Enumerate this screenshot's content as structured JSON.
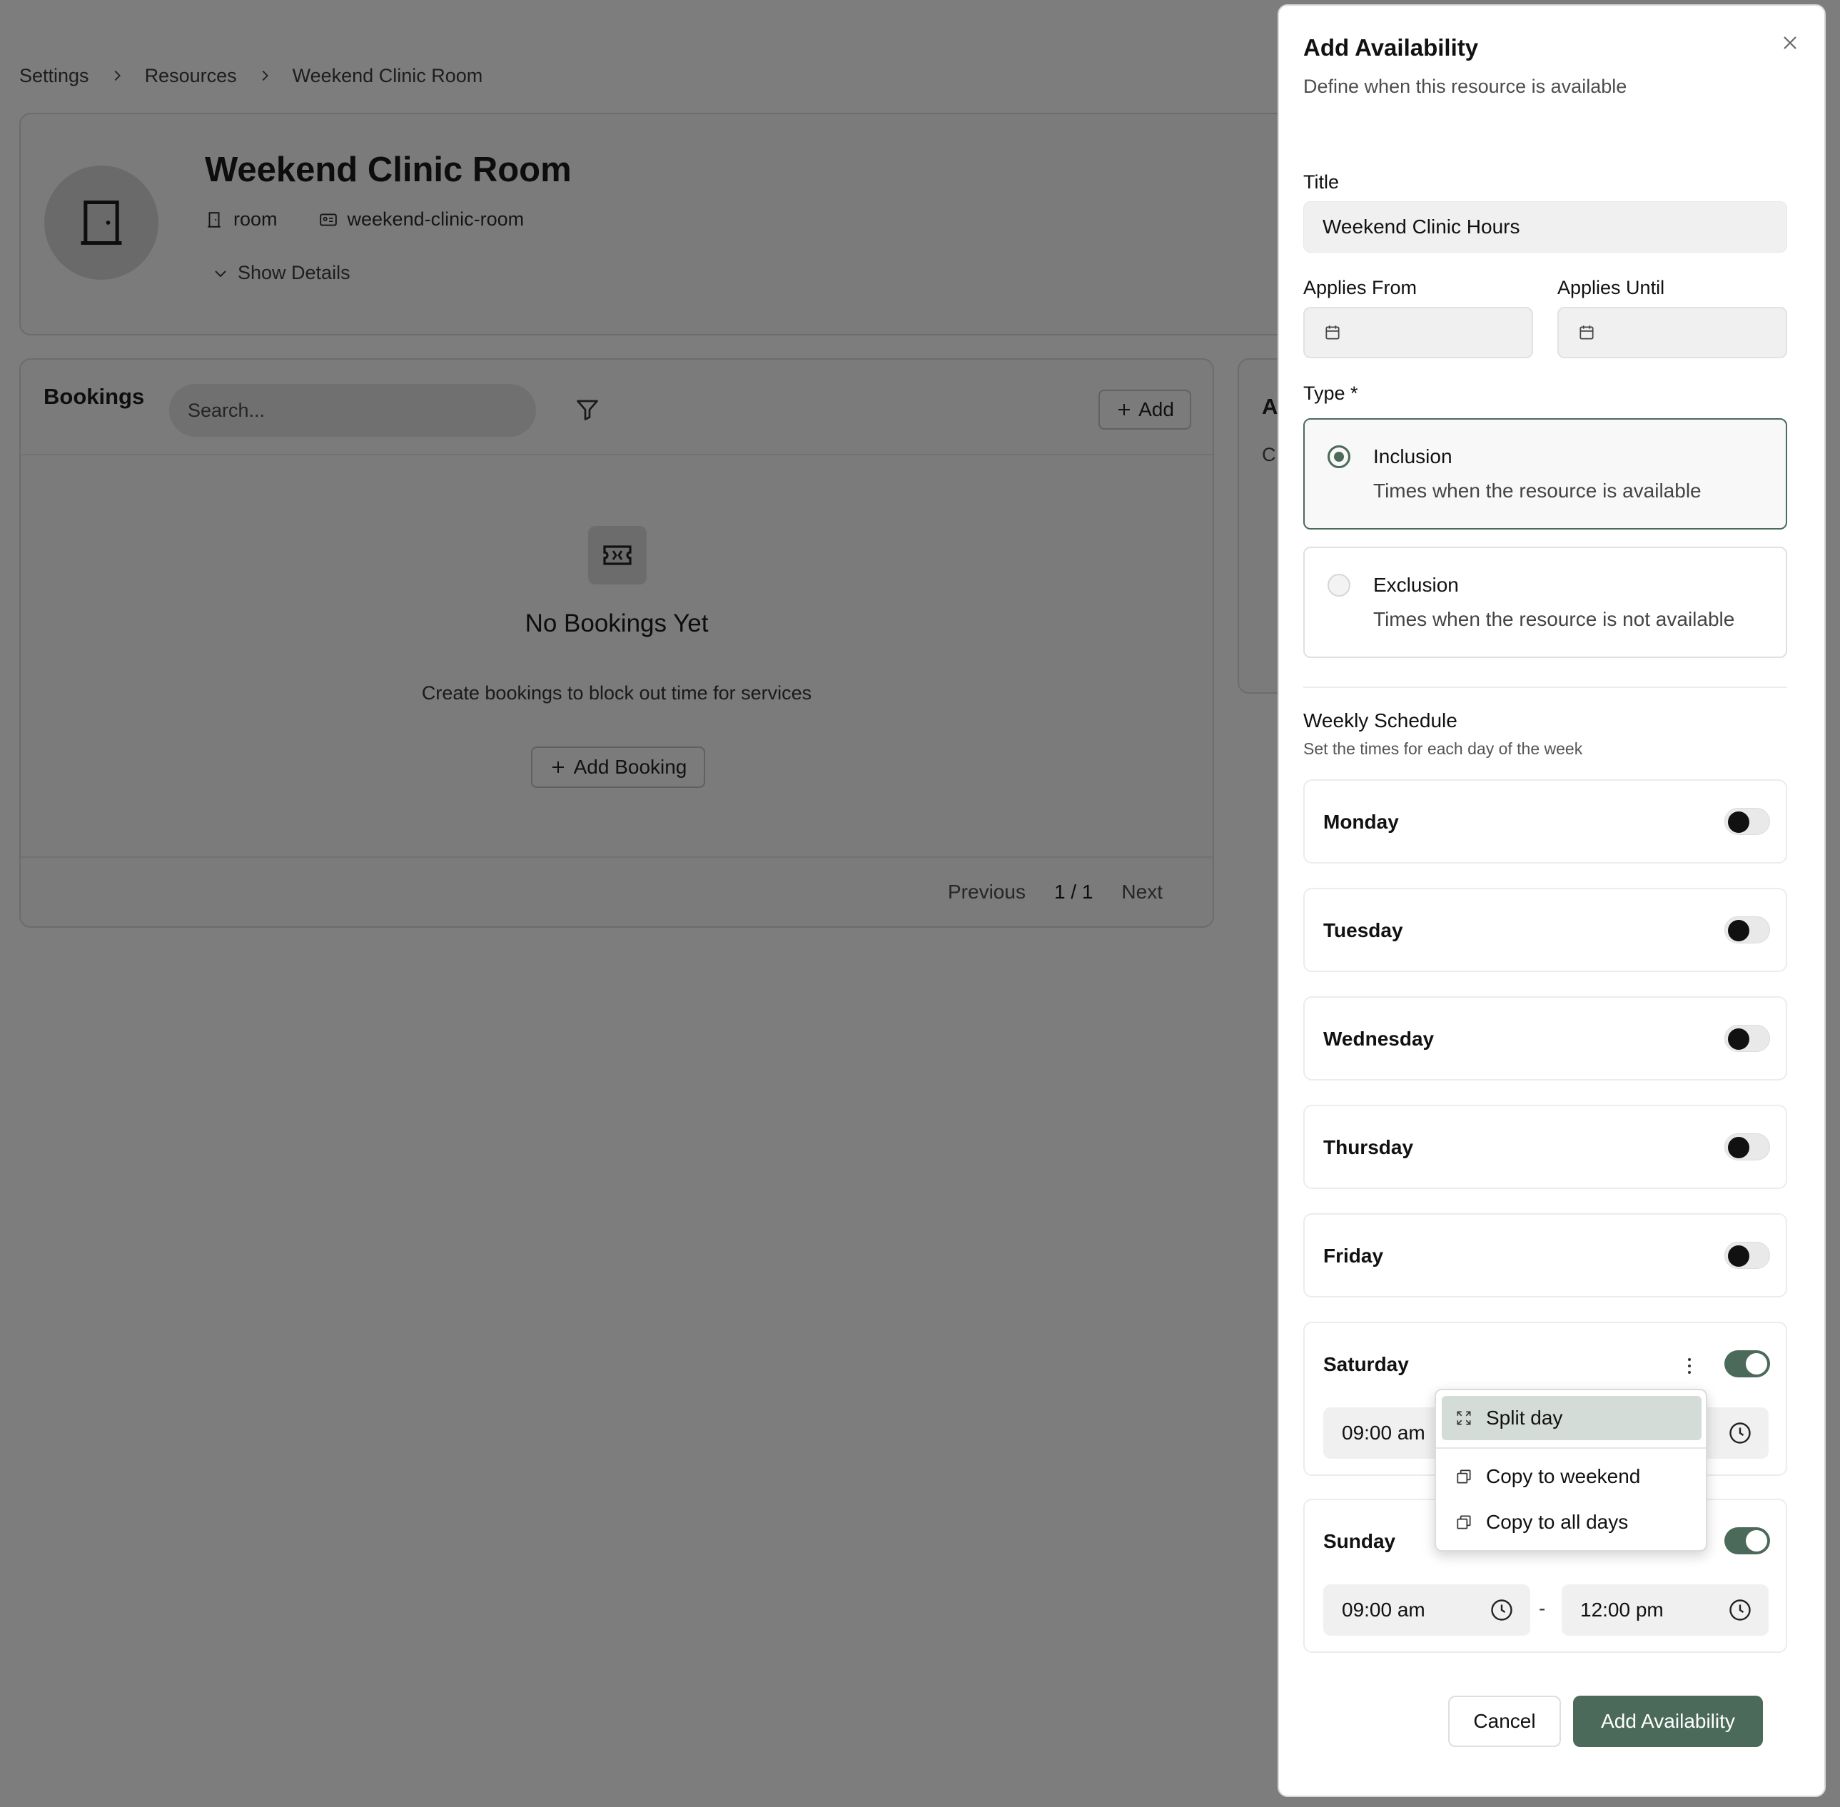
{
  "breadcrumb": [
    "Settings",
    "Resources",
    "Weekend Clinic Room"
  ],
  "resource": {
    "name": "Weekend Clinic Room",
    "type": "room",
    "slug": "weekend-clinic-room",
    "show_details": "Show Details"
  },
  "bookings": {
    "title": "Bookings",
    "search_placeholder": "Search...",
    "add_label": "Add",
    "empty_title": "No Bookings Yet",
    "empty_sub": "Create bookings to block out time for services",
    "add_booking_label": "Add Booking",
    "pager": {
      "prev": "Previous",
      "page": "1 / 1",
      "next": "Next"
    }
  },
  "side_card": {
    "title_initial": "A",
    "text_initial": "C"
  },
  "modal": {
    "title": "Add Availability",
    "subtitle": "Define when this resource is available",
    "title_label": "Title",
    "title_value": "Weekend Clinic Hours",
    "applies_from_label": "Applies From",
    "applies_until_label": "Applies Until",
    "type_label": "Type *",
    "options": [
      {
        "title": "Inclusion",
        "desc": "Times when the resource is available",
        "selected": true
      },
      {
        "title": "Exclusion",
        "desc": "Times when the resource is not available",
        "selected": false
      }
    ],
    "weekly_title": "Weekly Schedule",
    "weekly_sub": "Set the times for each day of the week",
    "days": [
      {
        "name": "Monday",
        "enabled": false
      },
      {
        "name": "Tuesday",
        "enabled": false
      },
      {
        "name": "Wednesday",
        "enabled": false
      },
      {
        "name": "Thursday",
        "enabled": false
      },
      {
        "name": "Friday",
        "enabled": false
      },
      {
        "name": "Saturday",
        "enabled": true,
        "start": "09:00 am"
      },
      {
        "name": "Sunday",
        "enabled": true,
        "start": "09:00 am",
        "end": "12:00 pm",
        "separator": "-"
      }
    ],
    "menu": [
      "Split day",
      "Copy to weekend",
      "Copy to all days"
    ],
    "cancel_label": "Cancel",
    "submit_label": "Add Availability"
  },
  "colors": {
    "accent": "#4b6a5a",
    "overlay": "#7d7d7d",
    "menu_highlight": "#d4dcd7"
  }
}
